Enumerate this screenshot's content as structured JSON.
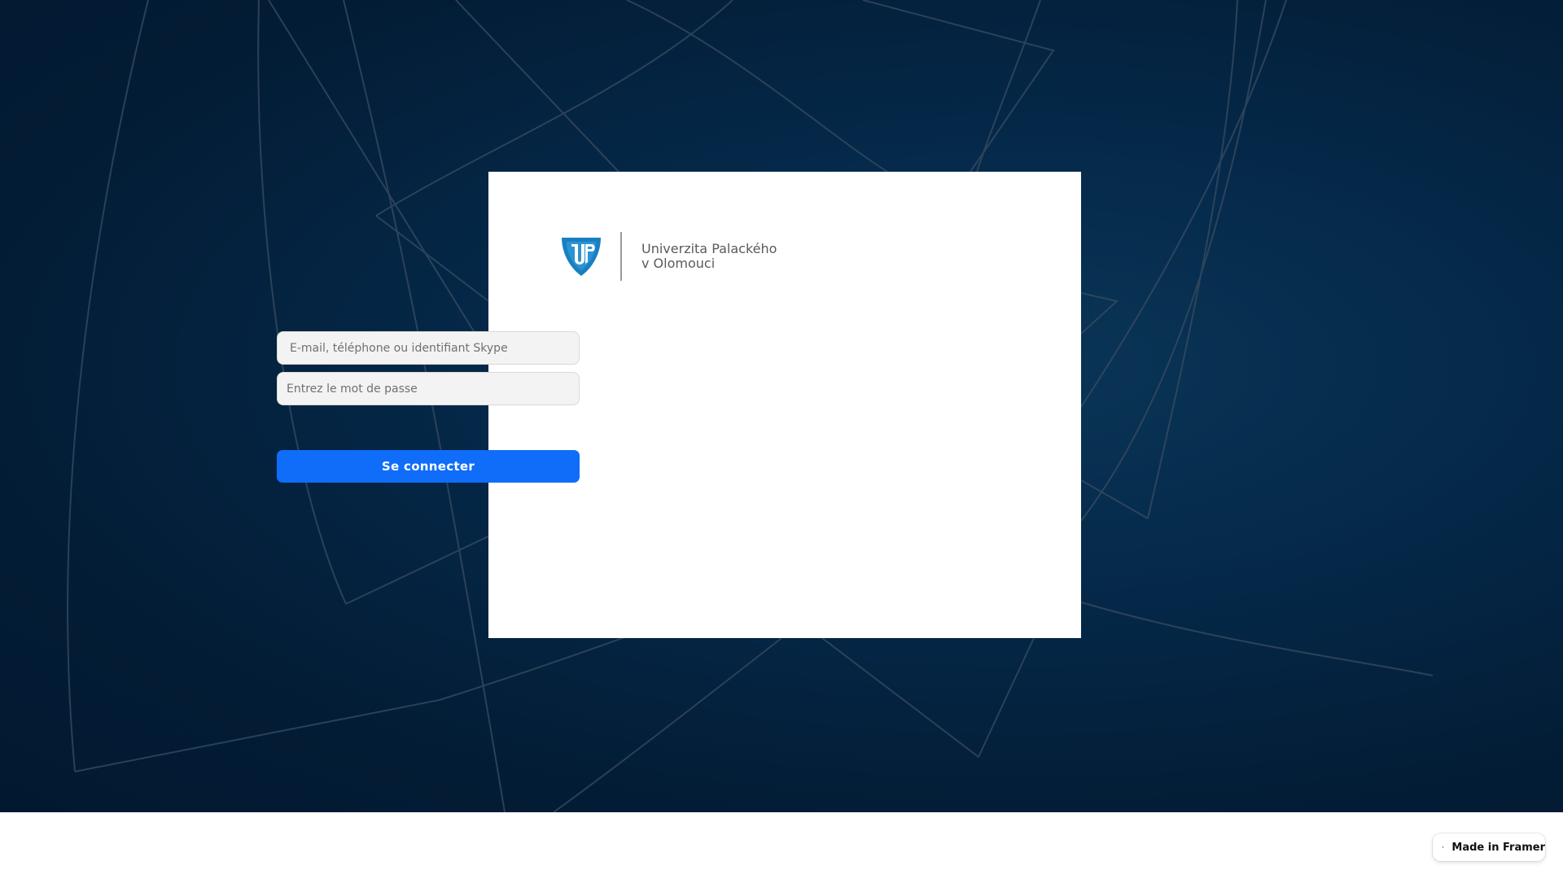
{
  "logo": {
    "line1": "Univerzita Palackého",
    "line2": "v Olomouci",
    "shield_icon": "up-shield-icon",
    "brand_color": "#1a7fc1"
  },
  "form": {
    "email_placeholder": "E-mail, téléphone ou identifiant Skype",
    "password_placeholder": "Entrez le mot de passe",
    "submit_label": "Se connecter"
  },
  "badge": {
    "label": "Made in Framer",
    "icon": "framer-logo-icon"
  },
  "colors": {
    "background": "#042443",
    "primary_button": "#0f6dfa",
    "card": "#ffffff"
  }
}
